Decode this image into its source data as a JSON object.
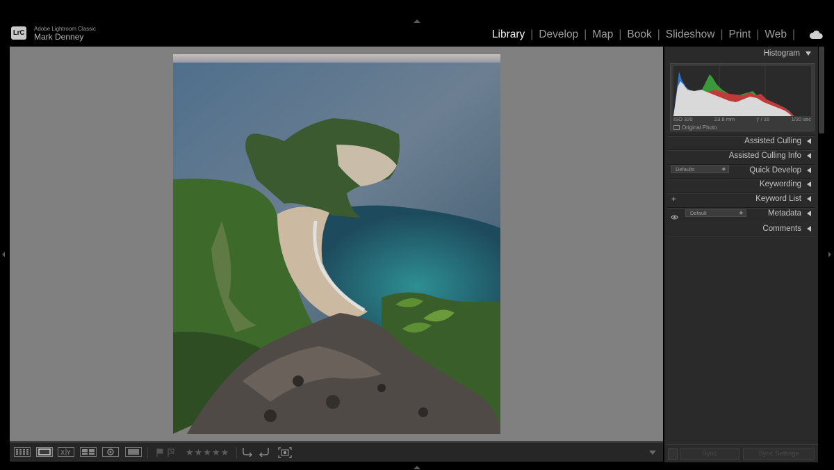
{
  "app": {
    "logo_text": "LrC",
    "product_name": "Adobe Lightroom Classic",
    "user_name": "Mark Denney"
  },
  "modules": [
    {
      "label": "Library",
      "active": true
    },
    {
      "label": "Develop",
      "active": false
    },
    {
      "label": "Map",
      "active": false
    },
    {
      "label": "Book",
      "active": false
    },
    {
      "label": "Slideshow",
      "active": false
    },
    {
      "label": "Print",
      "active": false
    },
    {
      "label": "Web",
      "active": false
    }
  ],
  "module_separator": "|",
  "cloud_icon": "cloud-icon",
  "photo": {
    "description_icon": "landscape-photo"
  },
  "toolbar": {
    "icons": [
      "grid-view-icon",
      "loupe-view-icon",
      "compare-view-icon",
      "survey-view-icon",
      "people-view-icon",
      "slideshow-icon",
      "flag-pick-icon",
      "flag-reject-icon",
      "rotate-left-icon",
      "rotate-right-icon",
      "crop-faces-icon"
    ],
    "stars": "★★★★★"
  },
  "panel": {
    "histogram": {
      "title": "Histogram",
      "iso": "ISO 320",
      "focal": "23.8 mm",
      "aperture": "ƒ / 16",
      "shutter": "1/20 sec",
      "original_photo_label": "Original Photo"
    },
    "sections": {
      "assisted_culling": "Assisted Culling",
      "assisted_culling_info": "Assisted Culling Info",
      "quick_develop": "Quick Develop",
      "quick_develop_preset": "Defaults",
      "keywording": "Keywording",
      "keyword_list": "Keyword List",
      "keyword_list_add": "+",
      "metadata": "Metadata",
      "metadata_preset": "Default",
      "comments": "Comments"
    },
    "sync": {
      "sync_label": "Sync",
      "sync_settings_label": "Sync Settings"
    }
  },
  "colors": {
    "background": "#000000",
    "viewer": "#808080",
    "panel": "#2a2a2a",
    "active_module": "#f2f2f2"
  }
}
